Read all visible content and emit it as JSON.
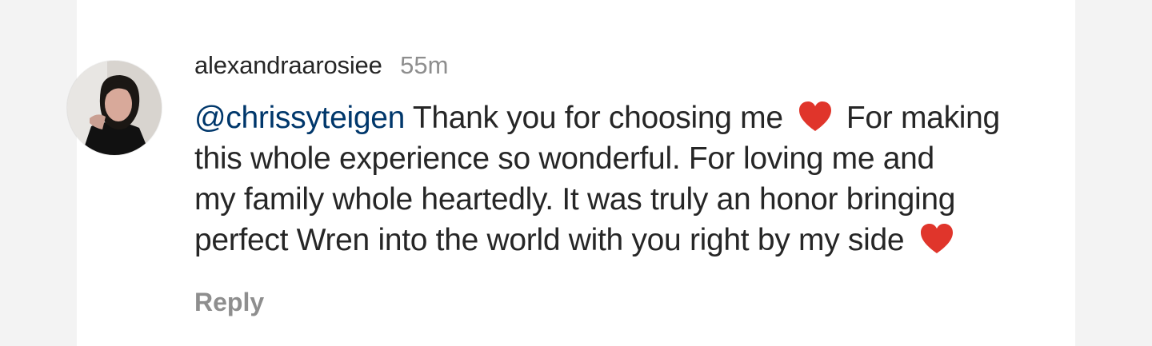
{
  "comment": {
    "username": "alexandraarosiee",
    "timestamp": "55m",
    "mention": "@chrissyteigen",
    "lines": {
      "line1_text": "Thank you for choosing me",
      "line1_after_heart": "For making",
      "line2": "this whole experience so wonderful. For loving me and",
      "line3": "my family whole heartedly. It was truly an honor bringing",
      "line4_text": "perfect Wren into the world with you right by my side"
    },
    "reply_label": "Reply"
  },
  "icons": {
    "avatar": "profile-photo",
    "heart": "red-heart-emoji"
  },
  "colors": {
    "username": "#262626",
    "text": "#262626",
    "mention": "#00376b",
    "muted": "#8e8e8e",
    "heart": "#e0352b"
  }
}
